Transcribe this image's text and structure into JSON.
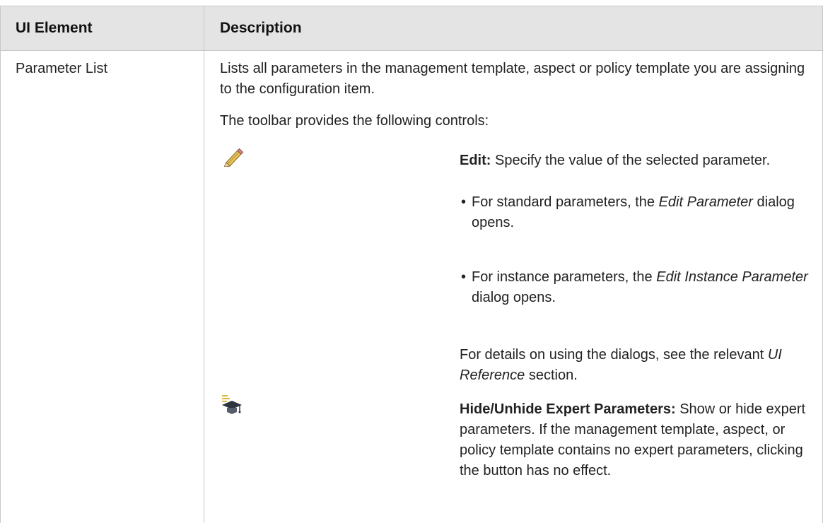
{
  "table": {
    "headers": [
      "UI Element",
      "Description"
    ],
    "row": {
      "element": "Parameter List",
      "intro": "Lists all parameters in the management template, aspect or policy template you are assigning to the configuration item.",
      "toolbar_intro": "The toolbar provides the following controls:",
      "controls": [
        {
          "icon": "pencil-edit-icon",
          "title": "Edit:",
          "text": "Specify the value of the selected parameter.",
          "bullets": [
            {
              "before": "For standard parameters, the",
              "em": "Edit Parameter",
              "after": "dialog opens."
            },
            {
              "before": "For instance parameters, the",
              "em": "Edit Instance Parameter",
              "after": "dialog opens."
            }
          ],
          "details": {
            "before": "For details on using the dialogs, see the relevant",
            "em": "UI Reference",
            "after": "section."
          }
        },
        {
          "icon": "graduation-cap-expert-icon",
          "title": "Hide/Unhide Expert Parameters:",
          "text": "Show or hide expert parameters. If the management template, aspect, or policy template contains no expert parameters, clicking the button has no effect."
        }
      ]
    }
  }
}
